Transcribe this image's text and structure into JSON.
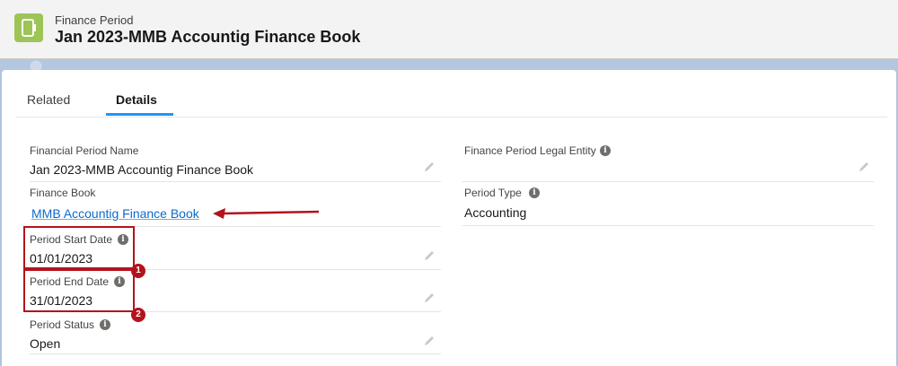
{
  "header": {
    "object_label": "Finance Period",
    "record_title": "Jan 2023-MMB Accountig Finance Book"
  },
  "tabs": [
    {
      "label": "Related",
      "active": false
    },
    {
      "label": "Details",
      "active": true
    }
  ],
  "fields_left": [
    {
      "label": "Financial Period Name",
      "value": "Jan 2023-MMB Accountig Finance Book"
    },
    {
      "label": "Finance Book",
      "value": "MMB Accountig Finance Book"
    },
    {
      "label": "Period Start Date",
      "value": "01/01/2023"
    },
    {
      "label": "Period End Date",
      "value": "31/01/2023"
    },
    {
      "label": "Period Status",
      "value": "Open"
    }
  ],
  "fields_right": [
    {
      "label": "Finance Period Legal Entity",
      "value": ""
    },
    {
      "label": "Period Type",
      "value": "Accounting"
    }
  ],
  "annotations": {
    "badge_1": "1",
    "badge_2": "2",
    "color": "#b3141c"
  },
  "colors": {
    "accent": "#1b96ff",
    "link": "#0b6bcb",
    "icon_bg": "#9dc456"
  },
  "icons": {
    "object": "tablet-icon",
    "info": "info-icon",
    "edit": "pencil-icon"
  }
}
